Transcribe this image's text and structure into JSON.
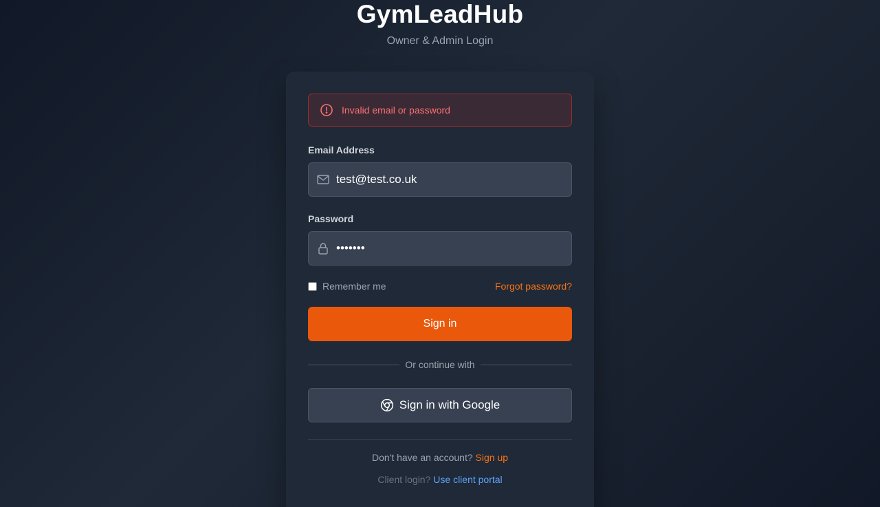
{
  "header": {
    "title": "GymLeadHub",
    "subtitle": "Owner & Admin Login"
  },
  "alert": {
    "message": "Invalid email or password",
    "icon": "alert-circle-icon",
    "color": "#f87171"
  },
  "form": {
    "email_label": "Email Address",
    "email_value": "test@test.co.uk",
    "email_icon": "mail-icon",
    "password_label": "Password",
    "password_value": "1234567",
    "password_icon": "lock-icon",
    "remember_label": "Remember me",
    "remember_checked": false,
    "forgot_label": "Forgot password?",
    "signin_label": "Sign in"
  },
  "divider": {
    "text": "Or continue with"
  },
  "google": {
    "label": "Sign in with Google",
    "icon": "chrome-icon"
  },
  "footer": {
    "signup_prompt": "Don't have an account?",
    "signup_link": "Sign up",
    "client_prompt": "Client login?",
    "client_link": "Use client portal"
  },
  "colors": {
    "accent": "#ea580c",
    "link_orange": "#f97316",
    "link_blue": "#60a5fa",
    "error": "#f87171"
  }
}
